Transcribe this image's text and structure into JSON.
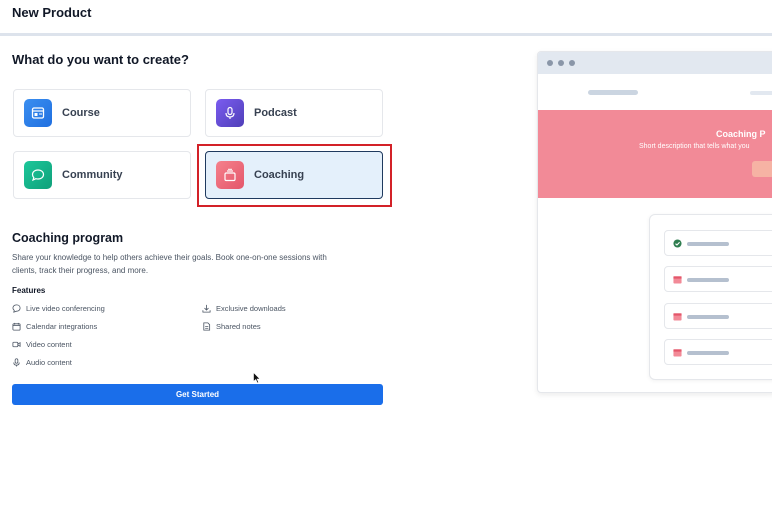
{
  "header": {
    "title": "New Product"
  },
  "picker": {
    "question": "What do you want to create?",
    "options": [
      {
        "label": "Course",
        "icon": "course-icon",
        "color": "#2f80ed"
      },
      {
        "label": "Podcast",
        "icon": "microphone-icon",
        "color": "#6b4fd8"
      },
      {
        "label": "Community",
        "icon": "chat-bubble-icon",
        "color": "#16b38a"
      },
      {
        "label": "Coaching",
        "icon": "coaching-icon",
        "color": "#f06a78",
        "selected": true
      }
    ]
  },
  "detail": {
    "title": "Coaching program",
    "description": "Share your knowledge to help others achieve their goals. Book one-on-one sessions with clients, track their progress, and more.",
    "features_title": "Features",
    "features": [
      {
        "label": "Live video conferencing",
        "icon": "chat-bubble-icon"
      },
      {
        "label": "Calendar integrations",
        "icon": "calendar-icon"
      },
      {
        "label": "Video content",
        "icon": "video-icon"
      },
      {
        "label": "Audio content",
        "icon": "microphone-icon"
      },
      {
        "label": "Exclusive downloads",
        "icon": "download-icon"
      },
      {
        "label": "Shared notes",
        "icon": "document-icon"
      }
    ],
    "cta_label": "Get Started"
  },
  "preview": {
    "hero_title": "Coaching P",
    "hero_subtitle": "Short description that tells what you",
    "hero_color": "#f28a97"
  }
}
